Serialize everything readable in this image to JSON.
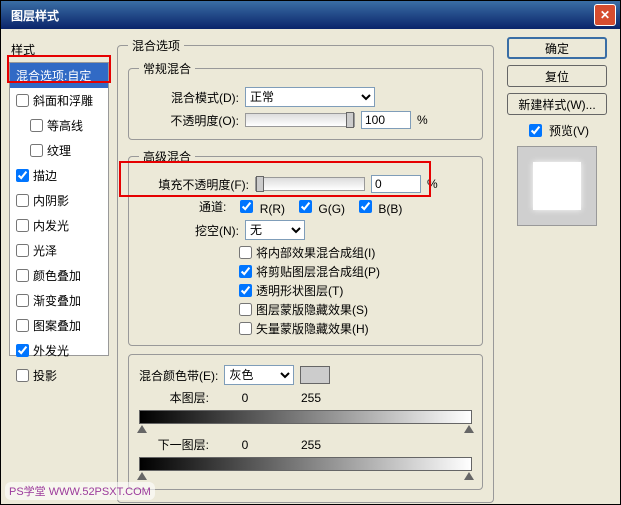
{
  "window": {
    "title": "图层样式"
  },
  "left": {
    "header": "样式",
    "items": [
      {
        "label": "混合选项:自定",
        "selected": true,
        "checkbox": false
      },
      {
        "label": "斜面和浮雕",
        "checked": false,
        "checkbox": true
      },
      {
        "label": "等高线",
        "checked": false,
        "checkbox": true,
        "indent": true
      },
      {
        "label": "纹理",
        "checked": false,
        "checkbox": true,
        "indent": true
      },
      {
        "label": "描边",
        "checked": true,
        "checkbox": true
      },
      {
        "label": "内阴影",
        "checked": false,
        "checkbox": true
      },
      {
        "label": "内发光",
        "checked": false,
        "checkbox": true
      },
      {
        "label": "光泽",
        "checked": false,
        "checkbox": true
      },
      {
        "label": "颜色叠加",
        "checked": false,
        "checkbox": true
      },
      {
        "label": "渐变叠加",
        "checked": false,
        "checkbox": true
      },
      {
        "label": "图案叠加",
        "checked": false,
        "checkbox": true
      },
      {
        "label": "外发光",
        "checked": true,
        "checkbox": true
      },
      {
        "label": "投影",
        "checked": false,
        "checkbox": true
      }
    ]
  },
  "middle": {
    "title": "混合选项",
    "general": {
      "legend": "常规混合",
      "blend_mode_label": "混合模式(D):",
      "blend_mode_value": "正常",
      "opacity_label": "不透明度(O):",
      "opacity_value": "100",
      "opacity_unit": "%"
    },
    "advanced": {
      "legend": "高级混合",
      "fill_label": "填充不透明度(F):",
      "fill_value": "0",
      "fill_unit": "%",
      "channels_label": "通道:",
      "ch_r": "R(R)",
      "ch_g": "G(G)",
      "ch_b": "B(B)",
      "knockout_label": "挖空(N):",
      "knockout_value": "无",
      "opt1": "将内部效果混合成组(I)",
      "opt2": "将剪贴图层混合成组(P)",
      "opt3": "透明形状图层(T)",
      "opt4": "图层蒙版隐藏效果(S)",
      "opt5": "矢量蒙版隐藏效果(H)"
    },
    "blendif": {
      "legend": "混合颜色带(E):",
      "gray": "灰色",
      "this_layer": "本图层:",
      "next_layer": "下一图层:",
      "val_low": "0",
      "val_high": "255"
    }
  },
  "right": {
    "ok": "确定",
    "cancel": "复位",
    "newstyle": "新建样式(W)...",
    "preview_label": "预览(V)"
  },
  "watermark": "PS学堂  WWW.52PSXT.COM"
}
